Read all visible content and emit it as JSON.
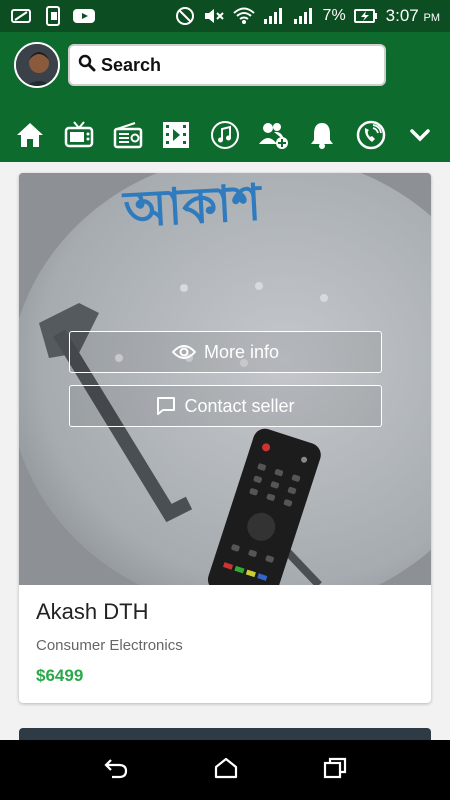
{
  "status_bar": {
    "battery_percent": "7%",
    "time": "3:07",
    "ampm": "PM"
  },
  "header": {
    "search_placeholder": "Search",
    "nav_icons": [
      "home-icon",
      "tv-icon",
      "radio-icon",
      "video-icon",
      "music-icon",
      "add-group-icon",
      "bell-icon",
      "phone-icon",
      "chevron-down-icon"
    ]
  },
  "product": {
    "title": "Akash DTH",
    "category": "Consumer Electronics",
    "price": "$6499",
    "more_info_label": "More info",
    "contact_seller_label": "Contact seller",
    "image_brand_text": "আকাশ"
  },
  "colors": {
    "status_bar": "#0d4d22",
    "header": "#0e6b2e",
    "price": "#2aa84a"
  }
}
